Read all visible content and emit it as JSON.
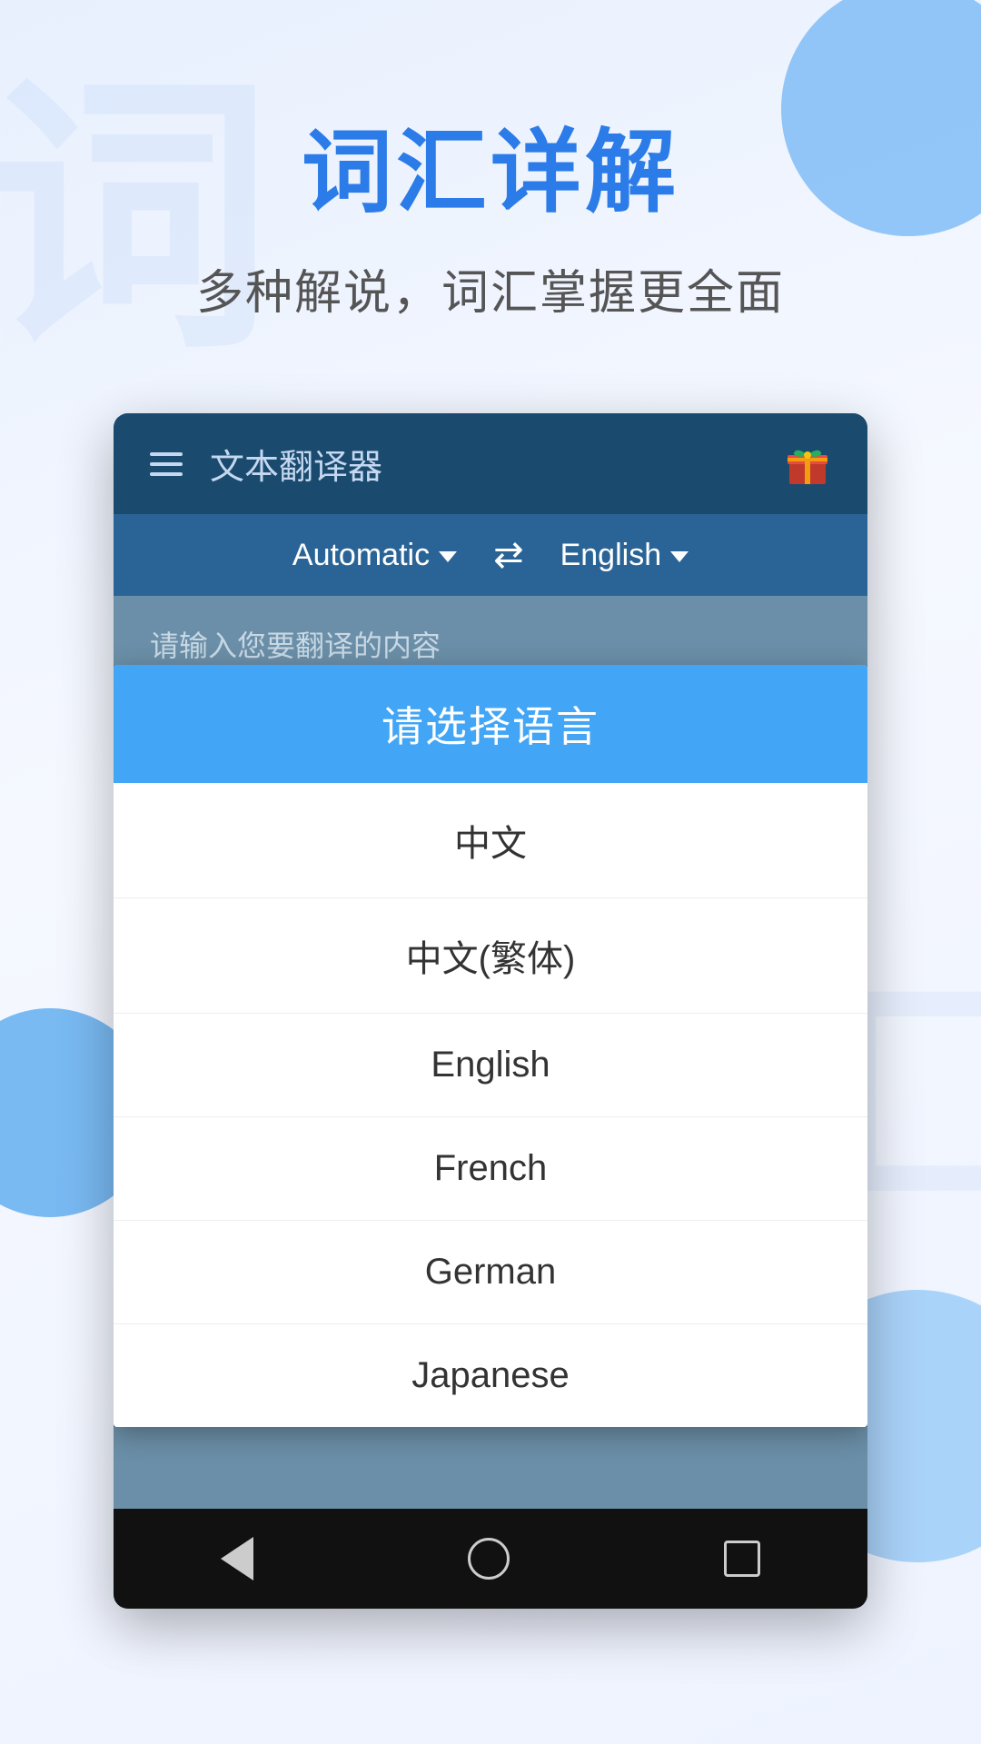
{
  "page": {
    "title": "词汇详解",
    "subtitle": "多种解说，词汇掌握更全面",
    "bg_watermark": "词",
    "bg_watermark_bottom": "汇"
  },
  "app": {
    "toolbar": {
      "title": "文本翻译器",
      "hamburger_label": "menu",
      "gift_label": "gift"
    },
    "lang_bar": {
      "source_lang": "Automatic",
      "target_lang": "English",
      "swap_symbol": "⇄"
    },
    "input_placeholder": "请输入您要翻译的内容"
  },
  "dialog": {
    "title": "请选择语言",
    "items": [
      {
        "label": "中文"
      },
      {
        "label": "中文(繁体)"
      },
      {
        "label": "English"
      },
      {
        "label": "French"
      },
      {
        "label": "German"
      },
      {
        "label": "Japanese"
      }
    ]
  },
  "navbar": {
    "back_label": "back",
    "home_label": "home",
    "recents_label": "recents"
  }
}
